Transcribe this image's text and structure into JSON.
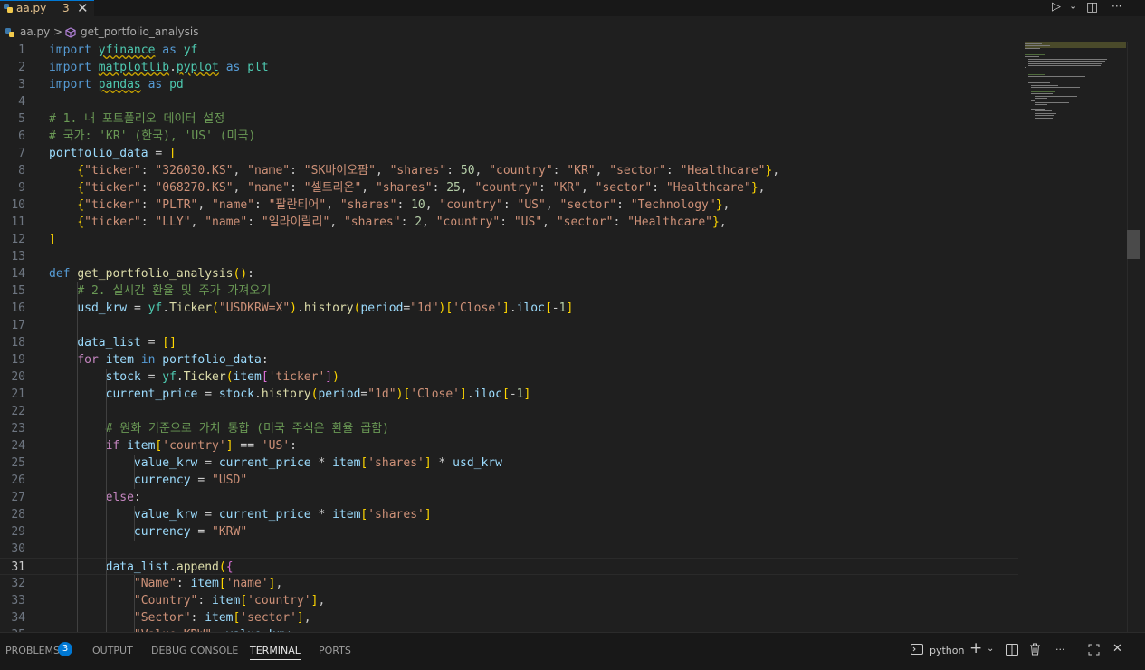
{
  "tab": {
    "filename": "aa.py",
    "problems_count": "3",
    "close": "✕"
  },
  "toolbar": {
    "run": "▷",
    "run_menu": "⌄",
    "split": "◫",
    "more": "···"
  },
  "breadcrumb": {
    "file": "aa.py",
    "separator": ">",
    "symbol": "get_portfolio_analysis"
  },
  "editor": {
    "language": "python",
    "current_line": 31,
    "lines": [
      "import yfinance as yf",
      "import matplotlib.pyplot as plt",
      "import pandas as pd",
      "",
      "# 1. 내 포트폴리오 데이터 설정",
      "# 국가: 'KR' (한국), 'US' (미국)",
      "portfolio_data = [",
      "    {\"ticker\": \"326030.KS\", \"name\": \"SK바이오팜\", \"shares\": 50, \"country\": \"KR\", \"sector\": \"Healthcare\"},",
      "    {\"ticker\": \"068270.KS\", \"name\": \"셀트리온\", \"shares\": 25, \"country\": \"KR\", \"sector\": \"Healthcare\"},",
      "    {\"ticker\": \"PLTR\", \"name\": \"팔란티어\", \"shares\": 10, \"country\": \"US\", \"sector\": \"Technology\"},",
      "    {\"ticker\": \"LLY\", \"name\": \"일라이릴리\", \"shares\": 2, \"country\": \"US\", \"sector\": \"Healthcare\"},",
      "]",
      "",
      "def get_portfolio_analysis():",
      "    # 2. 실시간 환율 및 주가 가져오기",
      "    usd_krw = yf.Ticker(\"USDKRW=X\").history(period=\"1d\")['Close'].iloc[-1]",
      "",
      "    data_list = []",
      "    for item in portfolio_data:",
      "        stock = yf.Ticker(item['ticker'])",
      "        current_price = stock.history(period=\"1d\")['Close'].iloc[-1]",
      "",
      "        # 원화 기준으로 가치 통합 (미국 주식은 환율 곱함)",
      "        if item['country'] == 'US':",
      "            value_krw = current_price * item['shares'] * usd_krw",
      "            currency = \"USD\"",
      "        else:",
      "            value_krw = current_price * item['shares']",
      "            currency = \"KRW\"",
      "",
      "        data_list.append({",
      "            \"Name\": item['name'],",
      "            \"Country\": item['country'],",
      "            \"Sector\": item['sector'],",
      "            \"Value_KRW\": value_krw,"
    ]
  },
  "panel": {
    "tabs": [
      "PROBLEMS",
      "OUTPUT",
      "DEBUG CONSOLE",
      "TERMINAL",
      "PORTS"
    ],
    "active_tab": "TERMINAL",
    "problems_badge": "3",
    "terminal_name": "python"
  },
  "colors": {
    "accent": "#0078d4",
    "background": "#1f1f1f",
    "panel": "#181818"
  }
}
